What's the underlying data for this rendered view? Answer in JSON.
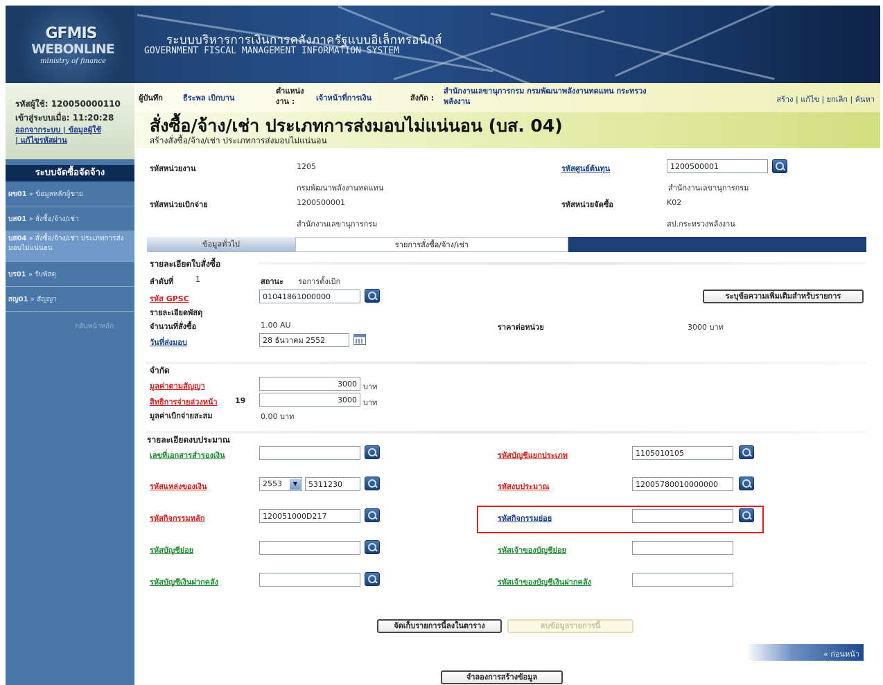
{
  "banner": {
    "logo_main": "GFMIS",
    "logo_sub": "WEBONLINE",
    "logo_tag": "ministry of finance",
    "title_th": "ระบบบริหารการเงินการคลังภาครัฐแบบอิเล็กทรอนิกส์",
    "title_en": "GOVERNMENT FISCAL MANAGEMENT INFORMATION SYSTEM"
  },
  "user": {
    "user_id_line": "รหัสผู้ใช้: 120050000110",
    "login_time_line": "เข้าสู่ระบบเมื่อ: 11:20:28",
    "links_line1": "ออกจากระบบ | ข้อมูลผู้ใช้",
    "links_line2": "| แก้ไขรหัสผ่าน"
  },
  "menu": {
    "title": "ระบบจัดซื้อจัดจ้าง",
    "items": [
      {
        "code": "ผข01",
        "label": "» ข้อมูลหลักผู้ขาย"
      },
      {
        "code": "บส01",
        "label": "» สั่งซื้อ/จ้าง/เช่า"
      },
      {
        "code": "บส04",
        "label": "» สั่งซื้อ/จ้าง/เช่า ประเภทการส่งมอบไม่แน่นอน"
      },
      {
        "code": "บร01",
        "label": "» รับพัสดุ"
      },
      {
        "code": "สญ01",
        "label": "» สัญญา"
      }
    ],
    "back": "กลับหน้าหลัก"
  },
  "info": {
    "recorder_label": "ผู้บันทึก",
    "recorder_value": "ธีระพล เบิกบาน",
    "position_label": "ตำแหน่ง งาน :",
    "position_value": "เจ้าหน้าที่การเงิน",
    "affiliation_label": "สังกัด :",
    "affiliation_value": "สำนักงานเลขานุการกรม กรมพัฒนาพลังงานทดแทน กระทรวงพลังงาน",
    "actions": [
      "สร้าง",
      "แก้ไข",
      "ยกเลิก",
      "ค้นหา"
    ]
  },
  "page": {
    "title": "สั่งซื้อ/จ้าง/เช่า ประเภทการส่งมอบไม่แน่นอน (บส. 04)",
    "subtitle": "สร้างสั่งซื้อ/จ้าง/เช่า ประเภทการส่งมอบไม่แน่นอน"
  },
  "header_fields": {
    "agency_label": "รหัสหน่วยงาน",
    "agency_code": "1205",
    "agency_name": "กรมพัฒนาพลังงานทดแทน",
    "cost_center_label": "รหัสศูนย์ต้นทุน",
    "cost_center_value": "1200500001",
    "cost_center_name": "สำนักงานเลขานุการกรม",
    "disb_unit_label": "รหัสหน่วยเบิกจ่าย",
    "disb_unit_code": "1200500001",
    "disb_unit_name": "สำนักงานเลขานุการกรม",
    "proc_unit_label": "รหัสหน่วยจัดซื้อ",
    "proc_unit_code": "K02",
    "proc_unit_name": "สป.กระทรวงพลังงาน"
  },
  "tabs": [
    "ข้อมูลทั่วไป",
    "รายการสั่งซื้อ/จ้าง/เช่า"
  ],
  "po_detail": {
    "section": "รายละเอียดใบสั่งซื้อ",
    "seq_label": "ลำดับที่",
    "seq_value": "1",
    "status_label": "สถานะ",
    "status_value": "รอการตั้งเบิก",
    "gpsc_label": "รหัส GPSC",
    "gpsc_value": "01041861000000",
    "extra_btn": "ระบุข้อความเพิ่มเติมสำหรับรายการ",
    "item_detail_label": "รายละเอียดพัสดุ",
    "qty_label": "จำนวนที่สั่งซื้อ",
    "qty_value": "1.00 AU",
    "unit_price_label": "ราคาต่อหน่วย",
    "unit_price_value": "3000 บาท",
    "delivery_label": "วันที่ส่งมอบ",
    "delivery_value": "28 ธันวาคม 2552"
  },
  "limit": {
    "section": "จำกัด",
    "contract_label": "มูลค่าตามสัญญา",
    "contract_value": "3000",
    "advance_label": "สิทธิการจ่ายล่วงหน้า",
    "advance_suffix": "19",
    "advance_value": "3000",
    "unit": "บาท",
    "accum_label": "มูลค่าเบิกจ่ายสะสม",
    "accum_value": "0.00 บาท"
  },
  "budget": {
    "section": "รายละเอียดงบประมาณ",
    "doc_no_label": "เลขที่เอกสารสำรองเงิน",
    "doc_no_value": "",
    "gl_label": "รหัสบัญชีแยกประเภท",
    "gl_value": "1105010105",
    "fund_label": "รหัสแหล่งของเงิน",
    "fund_year": "2553",
    "fund_value": "5311230",
    "budget_label": "รหัสงบประมาณ",
    "budget_value": "12005780010000000",
    "main_act_label": "รหัสกิจกรรมหลัก",
    "main_act_value": "120051000D217",
    "sub_act_label": "รหัสกิจกรรมย่อย",
    "sub_act_value": "",
    "sub_acct_label": "รหัสบัญชีย่อย",
    "sub_acct_value": "",
    "sub_acct_owner_label": "รหัสเจ้าของบัญชีย่อย",
    "sub_acct_owner_value": "",
    "deposit_acct_label": "รหัสบัญชีเงินฝากคลัง",
    "deposit_acct_value": "",
    "deposit_owner_label": "รหัสเจ้าของบัญชีเงินฝากคลัง",
    "deposit_owner_value": ""
  },
  "buttons": {
    "save_row": "จัดเก็บรายการนี้ลงในตาราง",
    "delete_row": "ลบข้อมูลรายการนี้",
    "prev": "« ก่อนหน้า",
    "simulate": "จำลองการสร้างข้อมูล"
  }
}
